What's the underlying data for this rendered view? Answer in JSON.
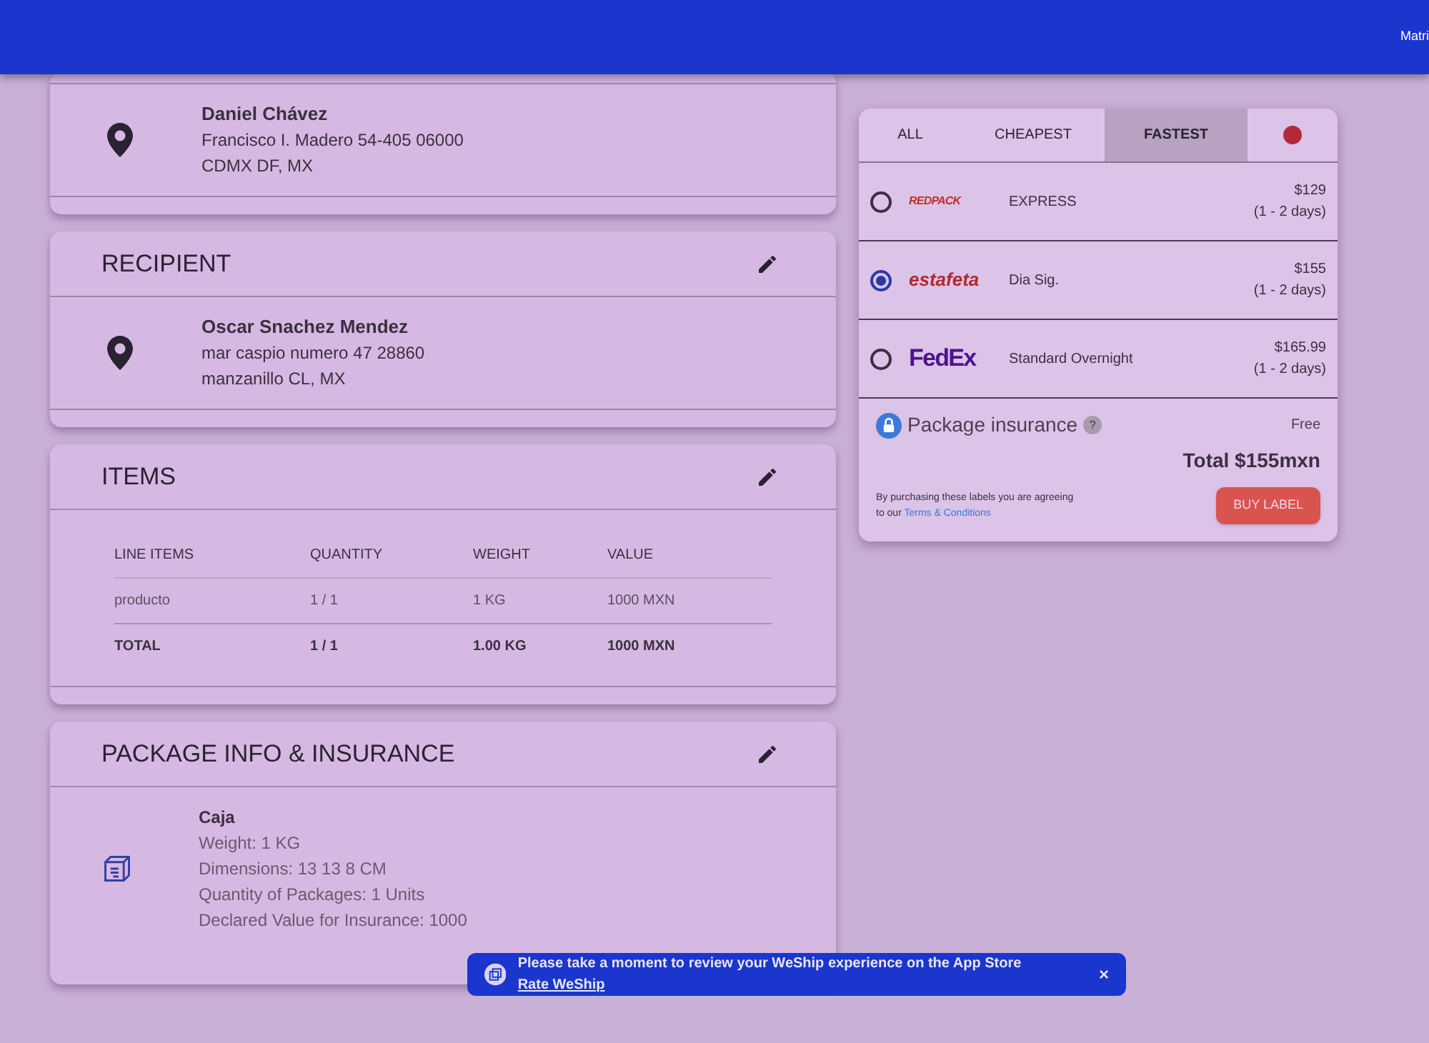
{
  "header": {
    "user": "Matri"
  },
  "sender": {
    "name": "Daniel Chávez",
    "lines": [
      "Francisco I. Madero 54-405 06000",
      "CDMX DF, MX"
    ]
  },
  "recipient": {
    "title": "RECIPIENT",
    "name": "Oscar Snachez Mendez",
    "lines": [
      "mar caspio numero 47 28860",
      "manzanillo CL, MX"
    ]
  },
  "items": {
    "title": "ITEMS",
    "columns": [
      "LINE ITEMS",
      "QUANTITY",
      "WEIGHT",
      "VALUE"
    ],
    "rows": [
      {
        "kind": "item",
        "cells": [
          "producto",
          "1 / 1",
          "1 KG",
          "1000 MXN"
        ]
      },
      {
        "kind": "total",
        "cells": [
          "TOTAL",
          "1 / 1",
          "1.00 KG",
          "1000 MXN"
        ]
      }
    ]
  },
  "package": {
    "title": "PACKAGE INFO & INSURANCE",
    "name": "Caja",
    "lines": [
      "Weight: 1 KG",
      "Dimensions: 13 13 8 CM",
      "Quantity of Packages: 1 Units",
      "Declared Value for Insurance: 1000"
    ]
  },
  "rates": {
    "tabs": [
      {
        "label": "ALL",
        "selected": false
      },
      {
        "label": "CHEAPEST",
        "selected": false
      },
      {
        "label": "FASTEST",
        "selected": true
      }
    ],
    "alert_tab": {
      "selected": false
    },
    "options": [
      {
        "logo": "REDPACK",
        "kind": "redpack",
        "service": "EXPRESS",
        "price": "$129",
        "days": "(1 - 2 days)",
        "selected": false
      },
      {
        "logo": "estafeta",
        "kind": "estafeta",
        "service": "Dia Sig.",
        "price": "$155",
        "days": "(1 - 2 days)",
        "selected": true
      },
      {
        "logo": "FedEx",
        "kind": "fedex",
        "service": "Standard Overnight",
        "price": "$165.99",
        "days": "(1 - 2 days)",
        "selected": false
      }
    ],
    "insurance": {
      "label": "Package insurance",
      "help": "?",
      "price": "Free"
    },
    "total": "Total $155mxn",
    "terms": {
      "text": "By purchasing these labels you are agreeing to our",
      "link": "Terms & Conditions"
    },
    "buy": "BUY LABEL"
  },
  "toast": {
    "text": "Please take a moment to review your WeShip experience on the App Store",
    "link": "Rate WeShip",
    "close": "×"
  }
}
